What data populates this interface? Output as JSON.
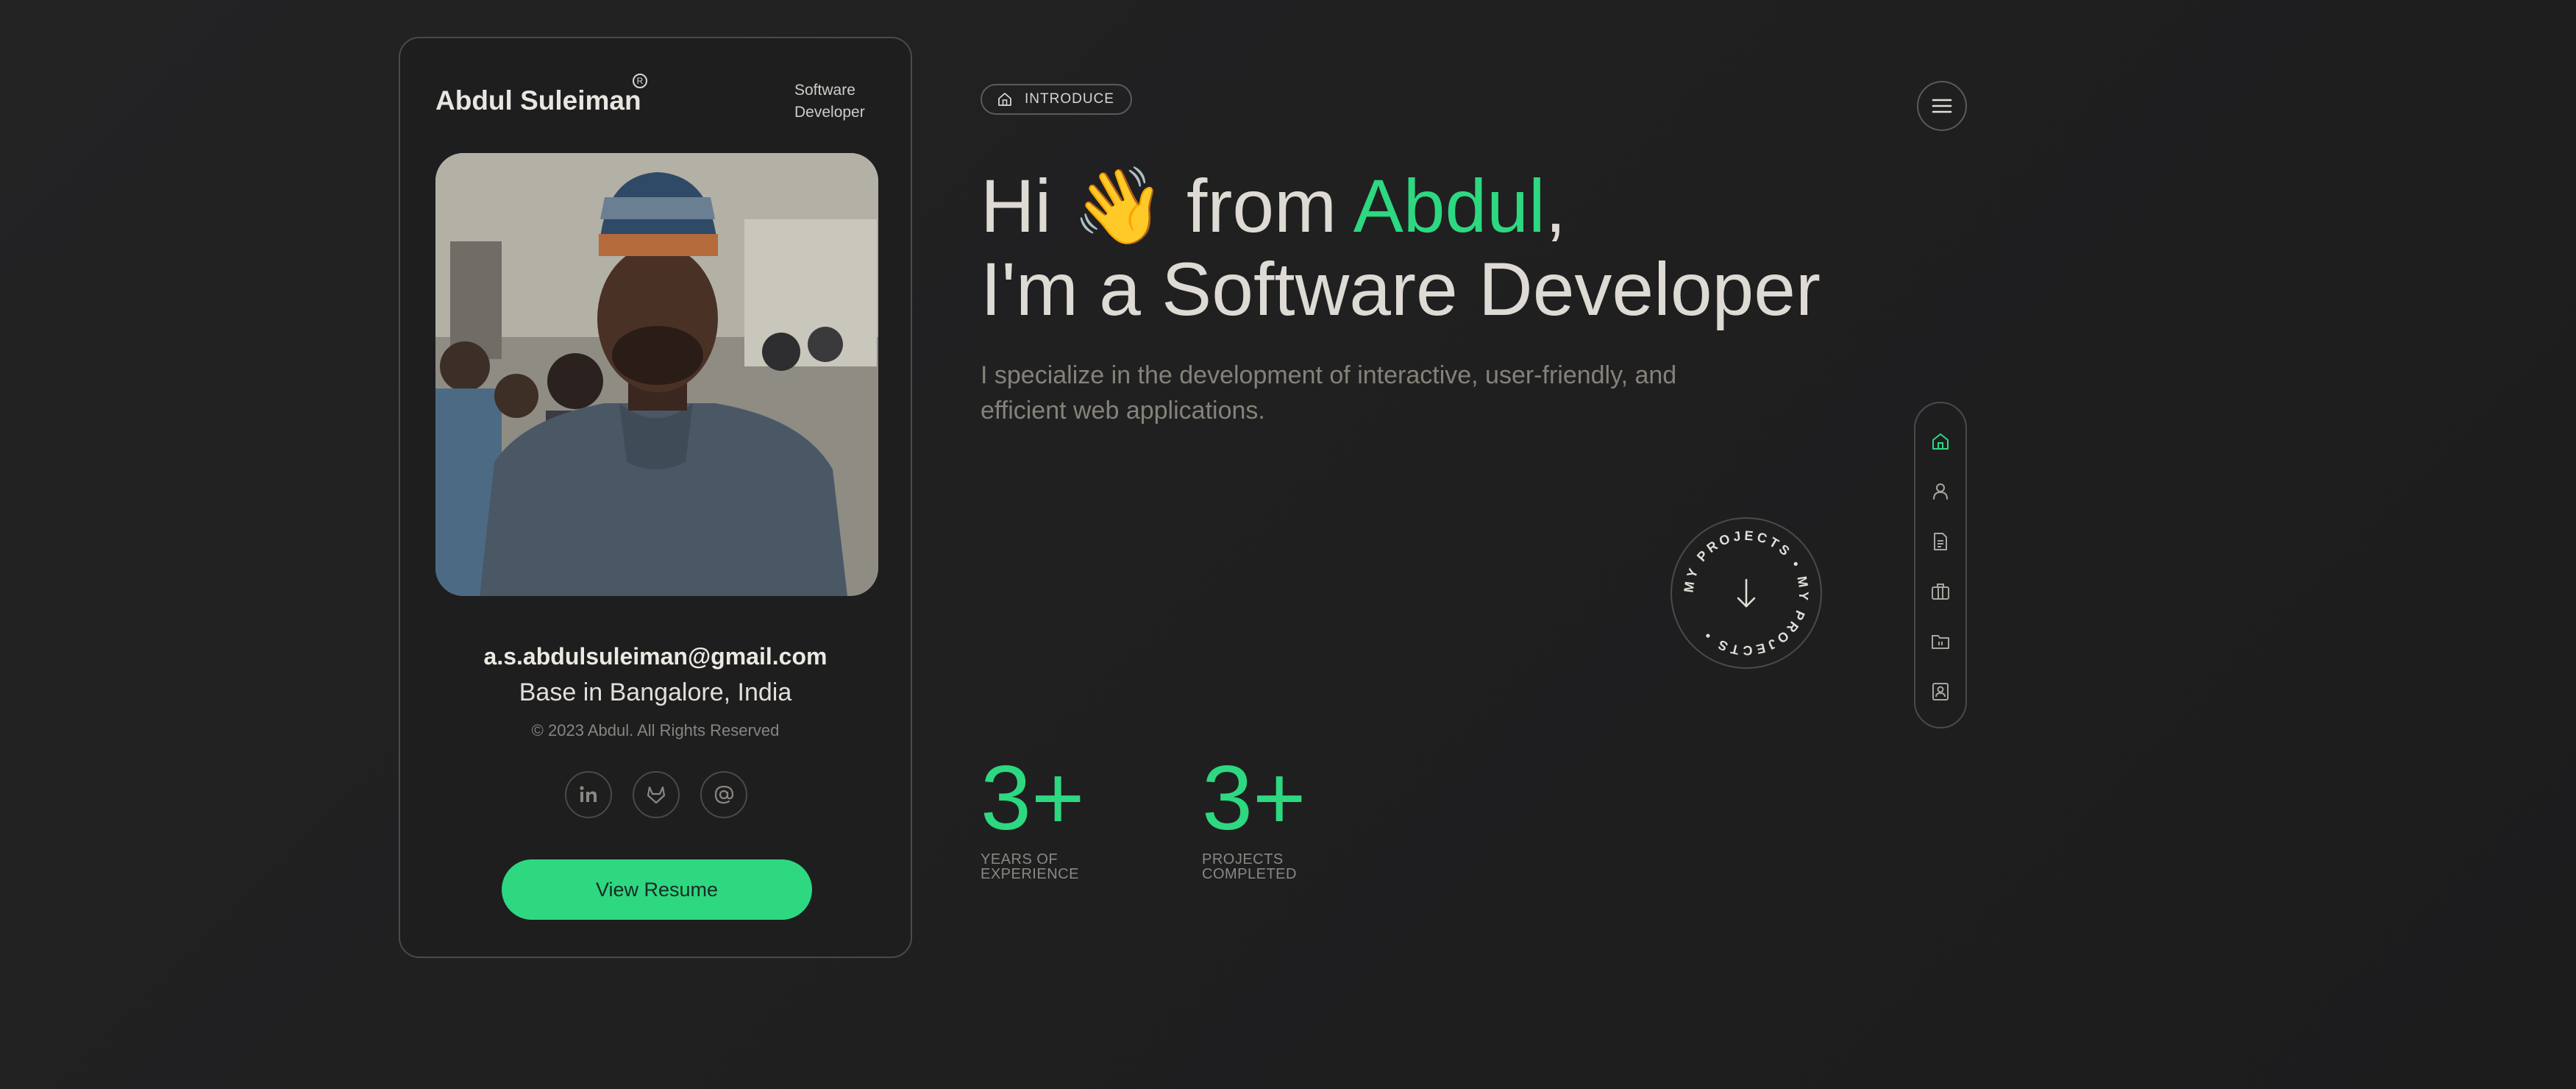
{
  "profile": {
    "name": "Abdul Suleiman",
    "registered_mark": "R",
    "role": "Software Developer",
    "email": "a.s.abdulsuleiman@gmail.com",
    "location": "Base in Bangalore, India",
    "copyright": "© 2023 Abdul. All Rights Reserved",
    "socials": [
      "linkedin-icon",
      "gitlab-icon",
      "at-icon"
    ],
    "resume_button": "View Resume"
  },
  "hero": {
    "tag": "INTRODUCE",
    "greeting_hi": "Hi",
    "wave_emoji": "👋",
    "greeting_from": "from",
    "name_accent": "Abdul",
    "comma": ",",
    "line2": "I'm a Software Developer",
    "subtitle": "I specialize in the development of interactive, user-friendly, and efficient web applications."
  },
  "badge": {
    "ring_text": "MY PROJECTS • MY PROJECTS • ",
    "icon": "arrow-down-icon"
  },
  "stats": [
    {
      "value": "3+",
      "label_line1": "YEARS OF",
      "label_line2": "EXPERIENCE"
    },
    {
      "value": "3+",
      "label_line1": "PROJECTS",
      "label_line2": "COMPLETED"
    }
  ],
  "sidenav": {
    "items": [
      "home-icon",
      "user-icon",
      "document-icon",
      "briefcase-icon",
      "folder-icon",
      "contact-icon"
    ],
    "active": "home-icon"
  },
  "colors": {
    "accent": "#2dd881",
    "background": "#222223",
    "text": "#e6e2dc"
  }
}
